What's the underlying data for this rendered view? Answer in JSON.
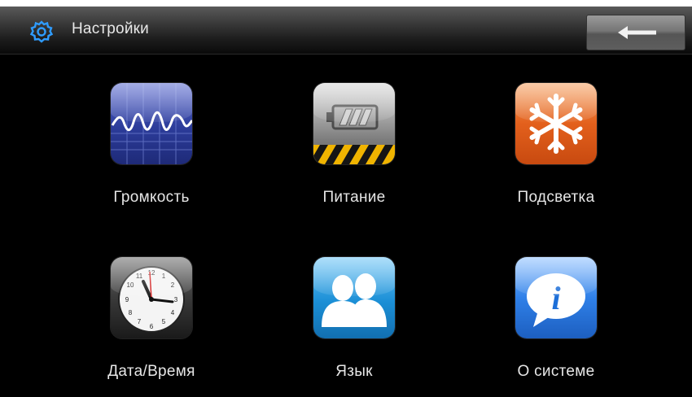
{
  "header": {
    "title": "Настройки",
    "gear_icon": "gear-icon",
    "back_icon": "back-arrow-icon"
  },
  "tiles": [
    {
      "label": "Громкость",
      "icon": "volume-waveform-icon"
    },
    {
      "label": "Питание",
      "icon": "battery-icon"
    },
    {
      "label": "Подсветка",
      "icon": "snowflake-icon"
    },
    {
      "label": "Дата/Время",
      "icon": "clock-icon"
    },
    {
      "label": "Язык",
      "icon": "people-icon"
    },
    {
      "label": "О системе",
      "icon": "info-icon"
    }
  ],
  "colors": {
    "screen_background": "#000000",
    "header_text": "#e8e8e8",
    "gear_accent": "#2f9cff",
    "volume_icon": "#2c3c9a",
    "backlight_icon": "#e3601c",
    "language_icon": "#1b8fd6",
    "info_icon": "#1d6fd8"
  }
}
